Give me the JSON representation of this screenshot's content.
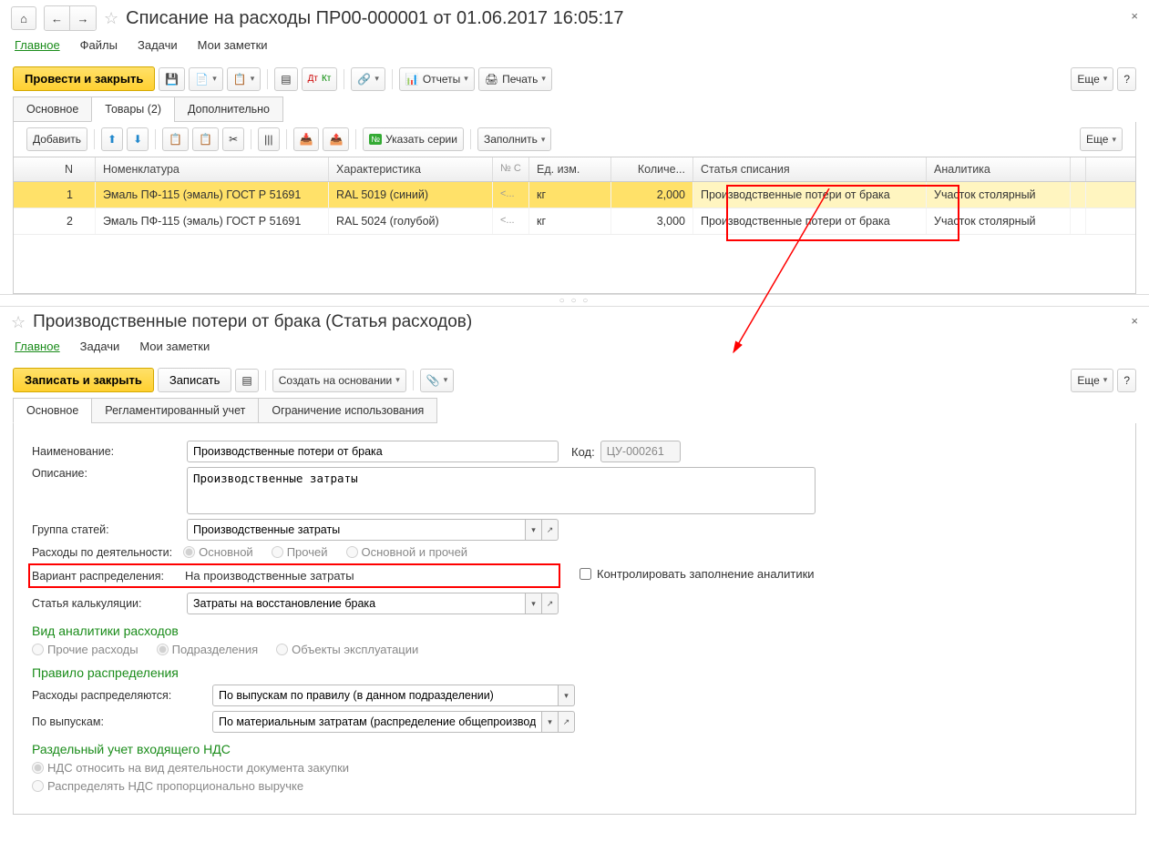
{
  "top": {
    "title": "Списание на расходы ПР00-000001 от 01.06.2017 16:05:17",
    "nav": [
      "Главное",
      "Файлы",
      "Задачи",
      "Мои заметки"
    ],
    "provide_close": "Провести и закрыть",
    "reports": "Отчеты",
    "print": "Печать",
    "more": "Еще",
    "sub_tabs": [
      "Основное",
      "Товары (2)",
      "Дополнительно"
    ],
    "add": "Добавить",
    "series": "Указать серии",
    "fill": "Заполнить",
    "headers": {
      "n": "N",
      "nom": "Номенклатура",
      "char": "Характеристика",
      "s": "№ С",
      "unit": "Ед. изм.",
      "qty": "Количе...",
      "art": "Статья списания",
      "an": "Аналитика"
    },
    "rows": [
      {
        "n": "1",
        "nom": "Эмаль ПФ-115 (эмаль) ГОСТ Р 51691",
        "char": "RAL 5019 (синий)",
        "s": "<...",
        "unit": "кг",
        "qty": "2,000",
        "art": "Производственные потери от брака",
        "an": "Участок столярный"
      },
      {
        "n": "2",
        "nom": "Эмаль ПФ-115 (эмаль) ГОСТ Р 51691",
        "char": "RAL 5024 (голубой)",
        "s": "<...",
        "unit": "кг",
        "qty": "3,000",
        "art": "Производственные потери от брака",
        "an": "Участок столярный"
      }
    ]
  },
  "bottom": {
    "title": "Производственные потери от брака (Статья расходов)",
    "nav": [
      "Главное",
      "Задачи",
      "Мои заметки"
    ],
    "save_close": "Записать и закрыть",
    "save": "Записать",
    "create_based": "Создать на основании",
    "more": "Еще",
    "sub_tabs": [
      "Основное",
      "Регламентированный учет",
      "Ограничение использования"
    ],
    "labels": {
      "name": "Наименование:",
      "desc": "Описание:",
      "group": "Группа статей:",
      "activity": "Расходы по деятельности:",
      "variant": "Вариант распределения:",
      "calc": "Статья калькуляции:",
      "code": "Код:",
      "control": "Контролировать заполнение аналитики",
      "dist_by": "Расходы распределяются:",
      "by_rel": "По выпускам:"
    },
    "values": {
      "name": "Производственные потери от брака",
      "desc": "Производственные затраты",
      "group": "Производственные затраты",
      "variant": "На производственные затраты",
      "calc": "Затраты на восстановление брака",
      "code": "ЦУ-000261",
      "dist_by": "По выпускам по правилу (в данном подразделении)",
      "by_rel": "По материальным затратам (распределение общепроизводс"
    },
    "sections": {
      "analytics": "Вид аналитики расходов",
      "rule": "Правило распределения",
      "vat": "Раздельный учет входящего НДС"
    },
    "radios": {
      "act1": "Основной",
      "act2": "Прочей",
      "act3": "Основной и прочей",
      "an1": "Прочие расходы",
      "an2": "Подразделения",
      "an3": "Объекты эксплуатации",
      "vat1": "НДС относить на вид деятельности документа закупки",
      "vat2": "Распределять НДС пропорционально выручке"
    }
  }
}
